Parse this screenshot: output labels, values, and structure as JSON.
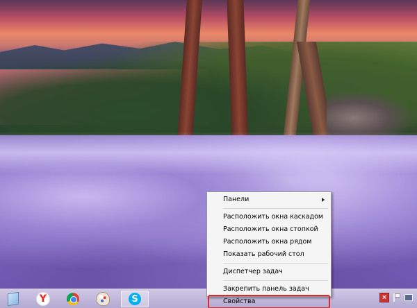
{
  "context_menu": {
    "items": [
      {
        "label": "Панели"
      },
      {
        "label": "Расположить окна каскадом"
      },
      {
        "label": "Расположить окна стопкой"
      },
      {
        "label": "Расположить окна рядом"
      },
      {
        "label": "Показать рабочий стол"
      },
      {
        "label": "Диспетчер задач"
      },
      {
        "label": "Закрепить панель задач"
      },
      {
        "label": "Свойства"
      }
    ]
  },
  "taskbar": {
    "pinned": [
      {
        "icon": "tablet-icon"
      },
      {
        "icon": "yandex-browser-icon",
        "glyph": "Y"
      },
      {
        "icon": "chrome-icon"
      },
      {
        "icon": "paint-icon"
      },
      {
        "icon": "skype-icon",
        "glyph": "S",
        "active": true
      }
    ],
    "tray": [
      {
        "icon": "action-center-icon"
      },
      {
        "icon": "flag-icon"
      },
      {
        "icon": "display-icon"
      }
    ]
  },
  "colors": {
    "highlight_outline": "#d62b2b",
    "menu_background": "#f5f5f5",
    "skype_blue": "#00aff0",
    "yandex_red": "#e52620"
  }
}
